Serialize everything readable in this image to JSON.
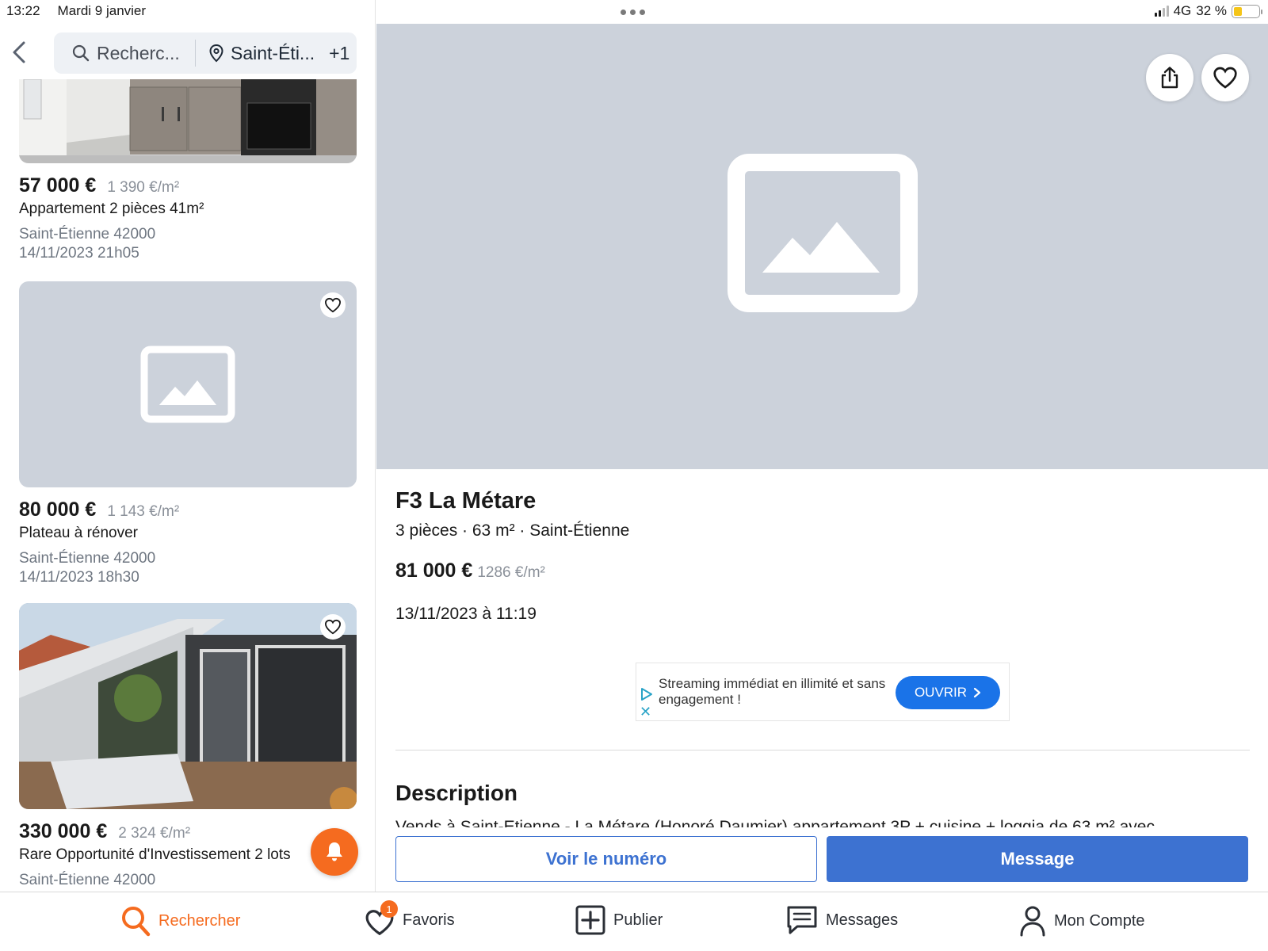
{
  "status_bar": {
    "time": "13:22",
    "date": "Mardi 9 janvier",
    "network": "4G",
    "battery_percent": "32 %",
    "battery_level": 0.32
  },
  "search": {
    "query": "Recherc...",
    "location": "Saint-Éti...",
    "extra_filters": "+1"
  },
  "listings": [
    {
      "price": "57 000 €",
      "price_per_m2": "1 390 €/m²",
      "title": "Appartement 2 pièces 41m²",
      "location": "Saint-Étienne 42000",
      "date": "14/11/2023 21h05",
      "photo": "kitchen-photo"
    },
    {
      "price": "80 000 €",
      "price_per_m2": "1 143 €/m²",
      "title": "Plateau à rénover",
      "location": "Saint-Étienne 42000",
      "date": "14/11/2023 18h30",
      "photo": "placeholder"
    },
    {
      "price": "330 000 €",
      "price_per_m2": "2 324 €/m²",
      "title": "Rare Opportunité d'Investissement 2 lots",
      "location": "Saint-Étienne 42000",
      "date": "",
      "photo": "terrace-photo"
    }
  ],
  "detail": {
    "title": "F3 La Métare",
    "subtitle": "3 pièces · 63 m² · Saint-Étienne",
    "price": "81 000 €",
    "price_per_m2": "1286 €/m²",
    "date": "13/11/2023 à 11:19",
    "description_title": "Description",
    "description_text": "Vends à Saint-Etienne - La Métare (Honoré Daumier) appartement 3P + cuisine + loggia de 63 m² avec",
    "call_button": "Voir le numéro",
    "message_button": "Message"
  },
  "ad_banner": {
    "text": "Streaming immédiat en illimité et sans engagement !",
    "cta": "OUVRIR"
  },
  "tabbar": {
    "search": "Rechercher",
    "favorites": "Favoris",
    "favorites_badge": "1",
    "publish": "Publier",
    "messages": "Messages",
    "account": "Mon Compte"
  },
  "colors": {
    "accent": "#f56b1f",
    "primary_blue": "#3d72d1",
    "placeholder_gray": "#ccd2db"
  }
}
